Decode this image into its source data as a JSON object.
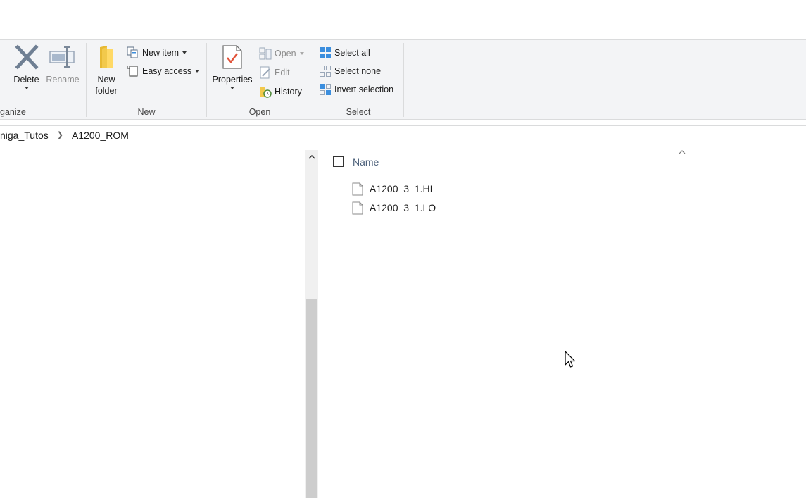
{
  "ribbon": {
    "organize": {
      "group_label": "ganize",
      "delete_label": "Delete",
      "rename_label": "Rename"
    },
    "new": {
      "group_label": "New",
      "new_folder_line1": "New",
      "new_folder_line2": "folder",
      "new_item_label": "New item",
      "easy_access_label": "Easy access"
    },
    "open": {
      "group_label": "Open",
      "properties_label": "Properties",
      "open_label": "Open",
      "edit_label": "Edit",
      "history_label": "History"
    },
    "select": {
      "group_label": "Select",
      "select_all_label": "Select all",
      "select_none_label": "Select none",
      "invert_selection_label": "Invert selection"
    }
  },
  "address_bar": {
    "crumbs": [
      "niga_Tutos",
      "A1200_ROM"
    ]
  },
  "file_list": {
    "column_name": "Name",
    "files": [
      {
        "name": "A1200_3_1.HI",
        "icon": "file-icon"
      },
      {
        "name": "A1200_3_1.LO",
        "icon": "file-icon"
      }
    ]
  },
  "colors": {
    "ribbon_bg": "#f3f4f6",
    "accent_blue": "#3b8ede",
    "column_header": "#4c607a"
  }
}
